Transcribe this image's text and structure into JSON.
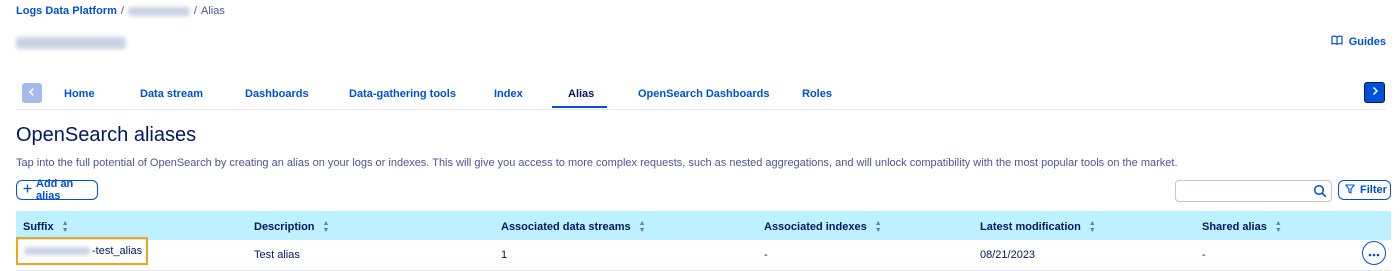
{
  "breadcrumb": {
    "root_label": "Logs Data Platform",
    "separator_1": "/",
    "separator_2": "/",
    "current_label": "Alias"
  },
  "header": {
    "guides_label": "Guides",
    "guides_icon": "book-icon"
  },
  "tabs": {
    "items": [
      {
        "label": "Home"
      },
      {
        "label": "Data stream"
      },
      {
        "label": "Dashboards"
      },
      {
        "label": "Data-gathering tools"
      },
      {
        "label": "Index"
      },
      {
        "label": "Alias",
        "active": true
      },
      {
        "label": "OpenSearch Dashboards"
      },
      {
        "label": "Roles"
      }
    ],
    "prev_icon": "chevron-left-icon",
    "next_icon": "chevron-right-icon"
  },
  "page": {
    "title": "OpenSearch aliases",
    "description": "Tap into the full potential of OpenSearch by creating an alias on your logs or indexes. This will give you access to more complex requests, such as nested aggregations, and will unlock compatibility with the most popular tools on the market."
  },
  "toolbar": {
    "add_alias_label": "Add an alias",
    "add_icon": "plus-icon",
    "search_value": "",
    "search_icon": "search-icon",
    "filter_label": "Filter",
    "filter_icon": "filter-icon"
  },
  "table": {
    "columns": [
      "Suffix",
      "Description",
      "Associated data streams",
      "Associated indexes",
      "Latest modification",
      "Shared alias"
    ],
    "rows": [
      {
        "suffix": "-test_alias",
        "description": "Test alias",
        "data_streams": "1",
        "indexes": "-",
        "latest_modification": "08/21/2023",
        "shared_alias": "-",
        "actions_icon": "more-horizontal-icon"
      }
    ]
  },
  "colors": {
    "primary": "#0050d7",
    "text_dark": "#00185e",
    "header_bg": "#bef1ff",
    "highlight": "#f5a21b"
  }
}
